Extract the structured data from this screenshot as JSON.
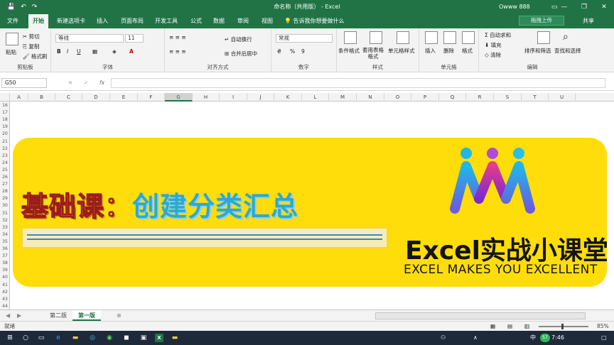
{
  "window": {
    "title": "命名称（共用版） - Excel",
    "user": "Owww 888",
    "controls": [
      "—",
      "❐",
      "✕"
    ]
  },
  "qat": {
    "save": "💾",
    "undo": "↶",
    "redo": "↷"
  },
  "tabs": [
    "文件",
    "开始",
    "新建选项卡",
    "插入",
    "页面布局",
    "开发工具",
    "公式",
    "数据",
    "审阅",
    "视图"
  ],
  "active_tab": "开始",
  "tellme": "💡 告诉我你想要做什么",
  "upload_btn": "拖拽上传",
  "share": "共享",
  "ribbon": {
    "clipboard": {
      "label": "剪贴板",
      "paste": "粘贴",
      "cut": "剪切",
      "copy": "复制",
      "format_painter": "格式刷"
    },
    "font": {
      "label": "字体",
      "name": "等线",
      "size": "11",
      "bold": "B",
      "italic": "I",
      "underline": "U"
    },
    "align": {
      "label": "对齐方式",
      "wrap": "自动换行",
      "merge": "合并后居中"
    },
    "number": {
      "label": "数字",
      "format": "常规",
      "pct": "%",
      "comma": "9"
    },
    "styles": {
      "label": "样式",
      "cond": "条件格式",
      "table": "套用表格格式",
      "cell": "单元格样式"
    },
    "cells": {
      "label": "单元格",
      "insert": "插入",
      "delete": "删除",
      "format": "格式"
    },
    "edit": {
      "label": "编辑",
      "autosum": "自动求和",
      "fill": "填充",
      "clear": "清除",
      "sort": "排序和筛选",
      "find": "查找和选择"
    }
  },
  "formula_bar": {
    "cell_ref": "G50",
    "fx": "fx",
    "cancel": "✕",
    "confirm": "✓",
    "value": ""
  },
  "columns": [
    "A",
    "B",
    "C",
    "D",
    "E",
    "F",
    "G",
    "H",
    "I",
    "J",
    "K",
    "L",
    "M",
    "N",
    "O",
    "P",
    "Q",
    "R",
    "S",
    "T",
    "U"
  ],
  "selected_column": "G",
  "rows": [
    "16",
    "17",
    "18",
    "19",
    "20",
    "21",
    "22",
    "23",
    "24",
    "25",
    "26",
    "27",
    "28",
    "29",
    "30",
    "31",
    "32",
    "33",
    "34",
    "35",
    "36",
    "37",
    "38",
    "39",
    "40",
    "41",
    "42",
    "43",
    "44"
  ],
  "banner": {
    "title_part1": "基础课：",
    "title_part2": "创建分类汇总",
    "brand": "Excel实战小课堂",
    "tagline": "EXCEL MAKES YOU EXCELLENT"
  },
  "sheets": [
    "第二版",
    "第一版"
  ],
  "active_sheet": "第一版",
  "add_sheet": "⊕",
  "status": {
    "ready": "就绪",
    "zoom": "85%"
  },
  "taskbar": {
    "time": "7:46",
    "lang": "中",
    "badge": "57"
  }
}
